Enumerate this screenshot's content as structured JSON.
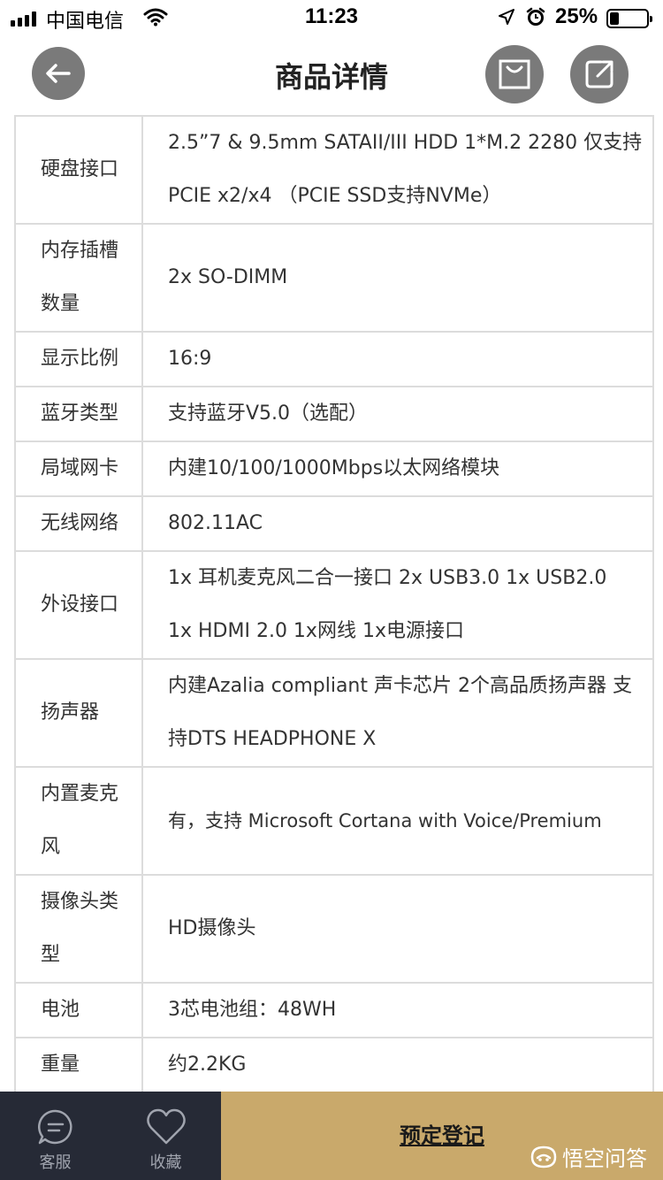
{
  "status_bar": {
    "carrier": "中国电信",
    "time": "11:23",
    "battery_percent": "25%",
    "battery_level": 0.25,
    "icons": [
      "signal-icon",
      "wifi-icon",
      "location-icon",
      "alarm-icon",
      "battery-icon"
    ]
  },
  "header": {
    "title": "商品详情",
    "icons": [
      "back-arrow-icon",
      "cart-icon",
      "share-icon"
    ]
  },
  "specs": [
    {
      "key": "硬盘接口",
      "value": "2.5”7 & 9.5mm SATAII/III HDD 1*M.2 2280 仅支持PCIE x2/x4 （PCIE SSD支持NVMe）"
    },
    {
      "key": "内存插槽数量",
      "value": "2x SO-DIMM"
    },
    {
      "key": "显示比例",
      "value": "16:9"
    },
    {
      "key": "蓝牙类型",
      "value": "支持蓝牙V5.0（选配）"
    },
    {
      "key": "局域网卡",
      "value": "内建10/100/1000Mbps以太网络模块"
    },
    {
      "key": "无线网络",
      "value": "802.11AC"
    },
    {
      "key": "外设接口",
      "value": "1x 耳机麦克风二合一接口 2x USB3.0 1x USB2.0 1x HDMI 2.0 1x网线 1x电源接口"
    },
    {
      "key": "扬声器",
      "value": "内建Azalia compliant 声卡芯片 2个高品质扬声器 支持DTS HEADPHONE X"
    },
    {
      "key": "内置麦克风",
      "value": "有，支持 Microsoft Cortana with Voice/Premium"
    },
    {
      "key": "摄像头类型",
      "value": "HD摄像头"
    },
    {
      "key": "电池",
      "value": "3芯电池组：48WH"
    },
    {
      "key": "重量",
      "value": "约2.2KG"
    }
  ],
  "bottom_bar": {
    "service_label": "客服",
    "favorite_label": "收藏",
    "reserve_label": "预定登记",
    "icons": [
      "chat-icon",
      "heart-icon"
    ],
    "colors": {
      "left_bg": "#262a36",
      "reserve_bg": "#c9a96b"
    }
  },
  "watermark": {
    "text": "悟空问答",
    "icon": "wukong-logo-icon"
  }
}
